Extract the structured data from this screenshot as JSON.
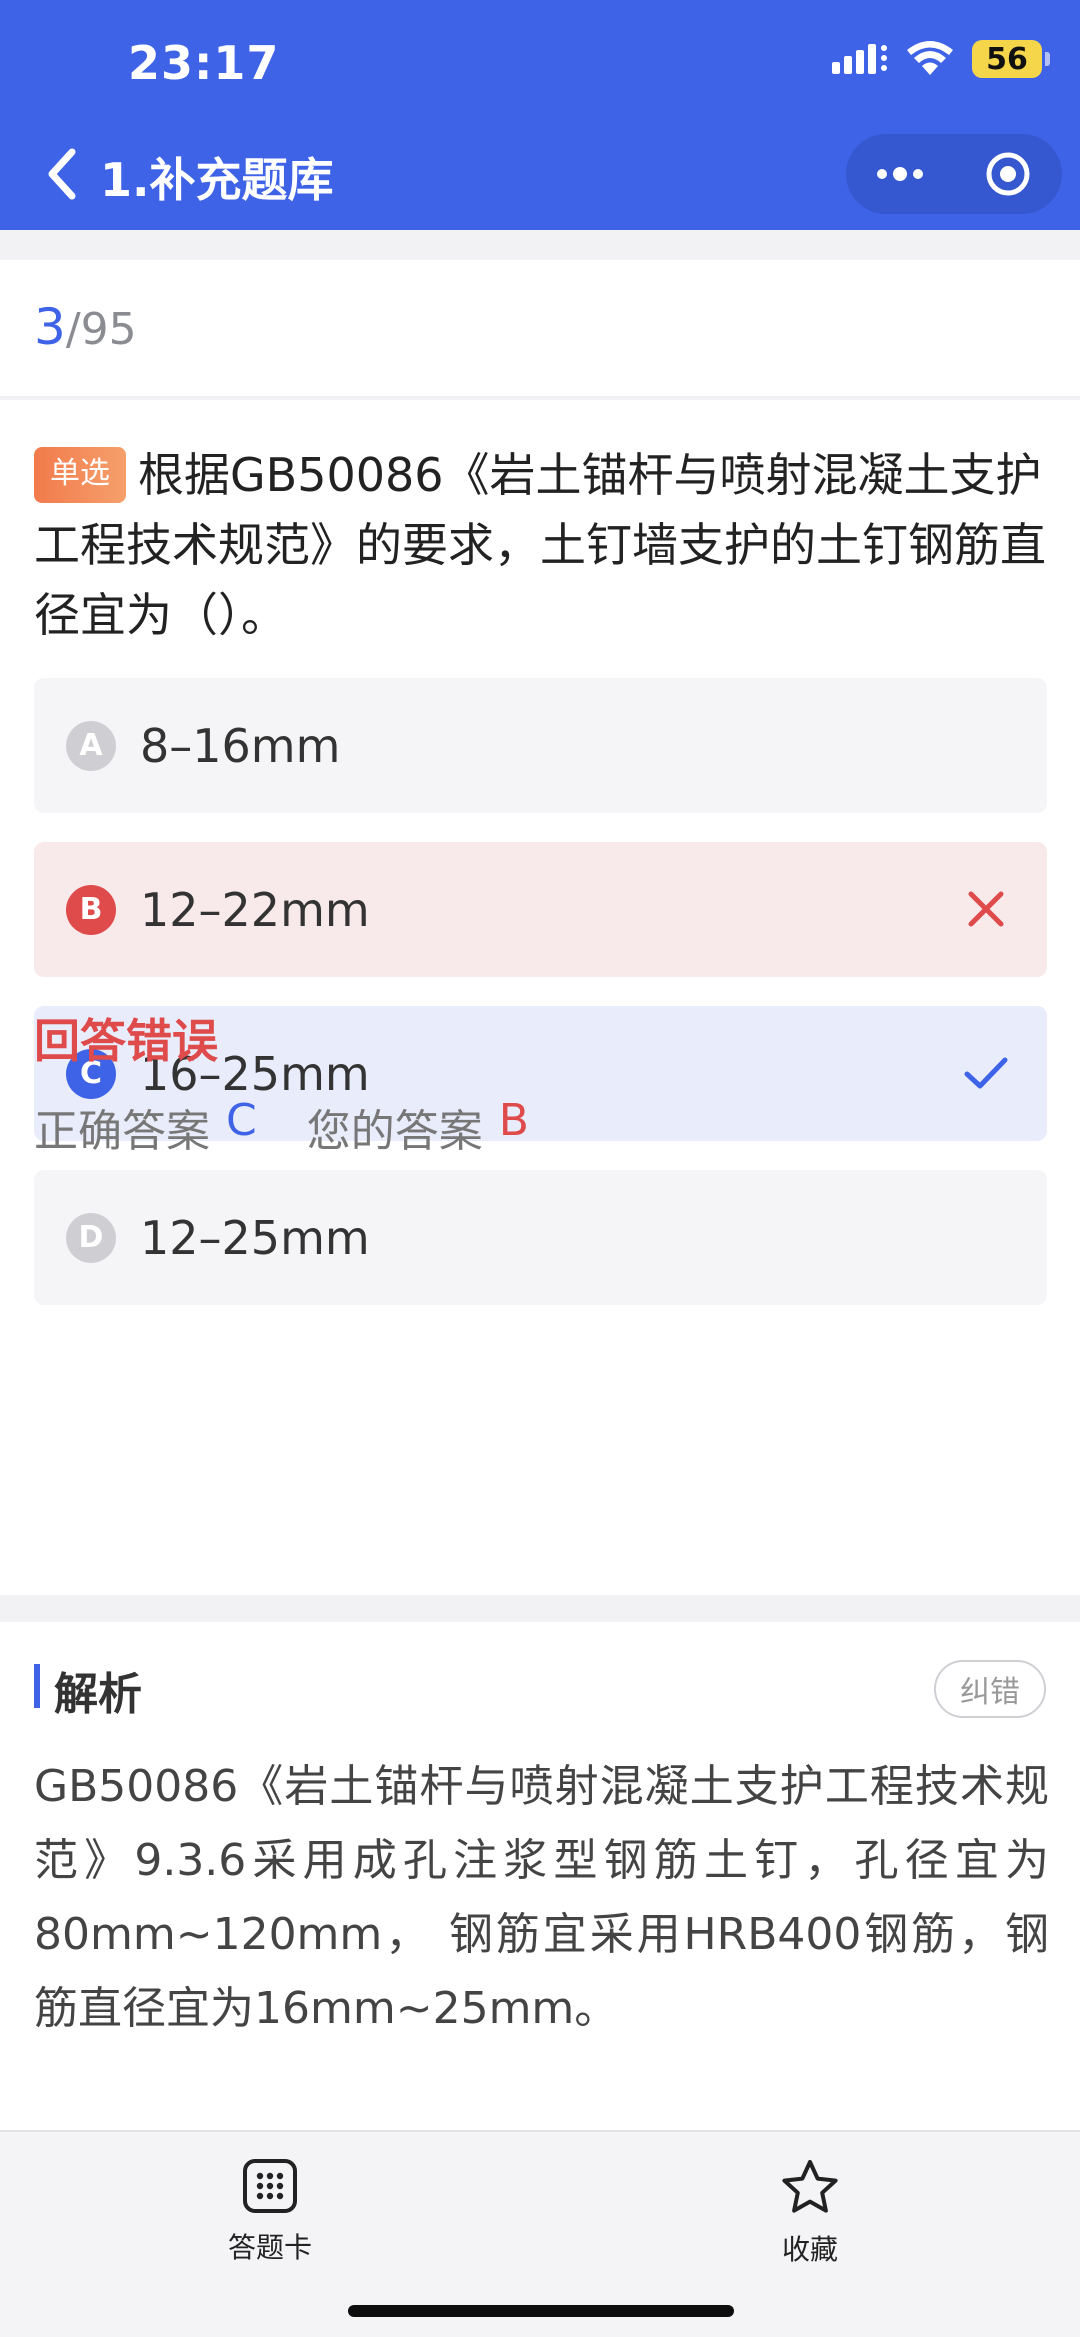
{
  "status_bar": {
    "time": "23:17",
    "battery": "56"
  },
  "nav": {
    "title": "1.补充题库"
  },
  "progress": {
    "current": "3",
    "total": "/95"
  },
  "question": {
    "tag": "单选",
    "text": "根据GB50086《岩土锚杆与喷射混凝土支护工程技术规范》的要求，土钉墙支护的土钉钢筋直径宜为（）。",
    "options": [
      {
        "letter": "A",
        "text": "8–16mm",
        "state": "normal"
      },
      {
        "letter": "B",
        "text": "12–22mm",
        "state": "wrong"
      },
      {
        "letter": "C",
        "text": "16–25mm",
        "state": "correct"
      },
      {
        "letter": "D",
        "text": "12–25mm",
        "state": "normal"
      }
    ]
  },
  "result": {
    "title": "回答错误",
    "correct_label": "正确答案",
    "correct_value": "C",
    "mine_label": "您的答案",
    "mine_value": "B"
  },
  "analysis": {
    "title": "解析",
    "feedback_label": "纠错",
    "text": "GB50086《岩土锚杆与喷射混凝土支护工程技术规范》9.3.6采用成孔注浆型钢筋土钉，孔径宜为80mm~120mm， 钢筋宜采用HRB400钢筋，钢筋直径宜为16mm~25mm。"
  },
  "bottom_tabs": [
    {
      "label": "答题卡",
      "icon": "grid-icon"
    },
    {
      "label": "收藏",
      "icon": "star-icon"
    }
  ],
  "colors": {
    "primary": "#3f63e7",
    "error": "#df4a4b",
    "tag": "#f27a4b"
  }
}
